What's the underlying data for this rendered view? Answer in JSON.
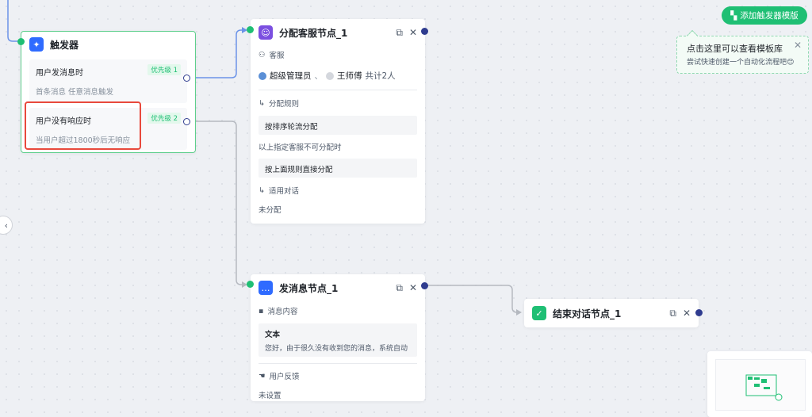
{
  "toolbar": {
    "add_template_label": "添加触发器模版"
  },
  "tip": {
    "title": "点击这里可以查看模板库",
    "desc": "尝试快速创建一个自动化流程吧😊",
    "close": "✕"
  },
  "trigger_node": {
    "title": "触发器",
    "conditions": [
      {
        "title": "用户发消息时",
        "desc": "首条消息   任意消息触发",
        "priority": "优先级 1"
      },
      {
        "title": "用户没有响应时",
        "desc": "当用户超过1800秒后无响应",
        "priority": "优先级 2"
      }
    ]
  },
  "assign_node": {
    "title": "分配客服节点_1",
    "agent_label": "客服",
    "agent_1": "超级管理员",
    "separator": "、",
    "agent_2": "王师傅",
    "agent_total": "共计2人",
    "rule_label": "分配规则",
    "rule_value": "按排序轮流分配",
    "fallback_text": "以上指定客服不可分配时",
    "fallback_value": "按上面规则直接分配",
    "scope_label": "适用对话",
    "scope_value": "未分配"
  },
  "message_node": {
    "title": "发消息节点_1",
    "content_label": "消息内容",
    "content_type": "文本",
    "content_text": "您好，由于很久没有收到您的消息，系统自动",
    "feedback_label": "用户反馈",
    "feedback_value": "未设置"
  },
  "end_node": {
    "title": "结束对话节点_1"
  },
  "colors": {
    "accent_green": "#1fbf74",
    "port_navy": "#2f3c8f",
    "edge_blue": "#6b93e8",
    "edge_gray": "#b5b9c0",
    "highlight_red": "#e8493c"
  }
}
